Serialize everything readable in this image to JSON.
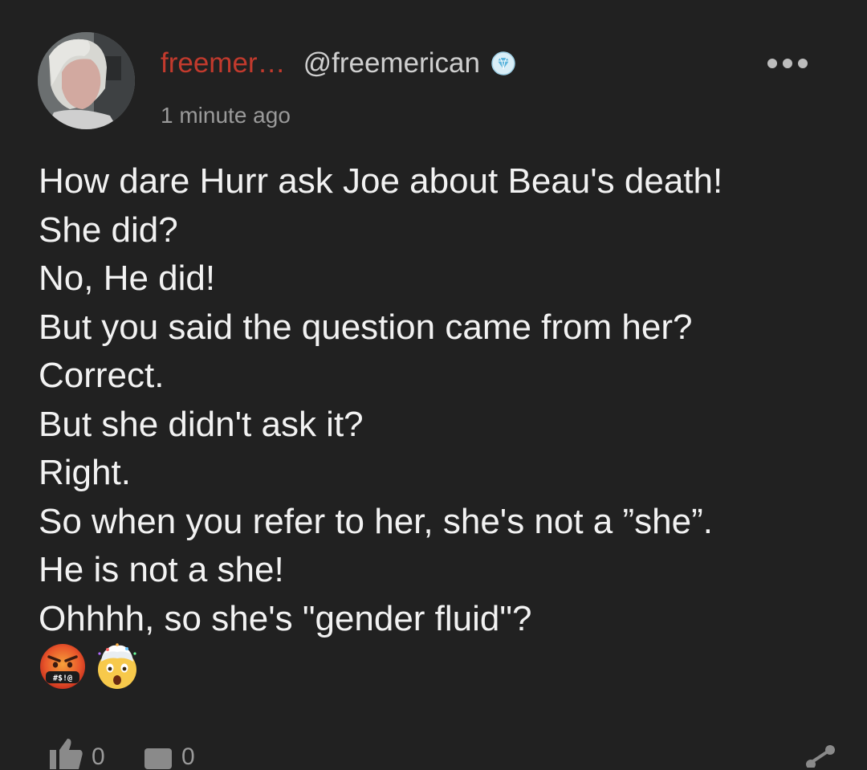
{
  "post": {
    "author": {
      "display_name": "freemer…",
      "handle": "@freemerican",
      "badge_icon": "diamond-verified-icon"
    },
    "timestamp": "1 minute ago",
    "menu_icon": "more-dots-icon",
    "body_lines": [
      "How dare Hurr ask Joe about Beau's death!",
      "She did?",
      "No, He did!",
      "But you said the question came from her?",
      "Correct.",
      "But she didn't ask it?",
      "Right.",
      "So when you refer to her, she's not a ”she”.",
      "He is not a she!",
      "Ohhhh, so she's \"gender fluid\"?"
    ],
    "emojis": [
      "face-with-symbols-on-mouth",
      "exploding-head"
    ],
    "actions": {
      "likes_count": "0",
      "comments_count": "0",
      "like_icon": "thumbs-up-icon",
      "comment_icon": "comment-icon",
      "share_icon": "share-icon"
    }
  },
  "colors": {
    "background": "#212121",
    "display_name": "#c23a2d",
    "body_text": "#f2f2f2",
    "muted_text": "#9a9a9a"
  }
}
